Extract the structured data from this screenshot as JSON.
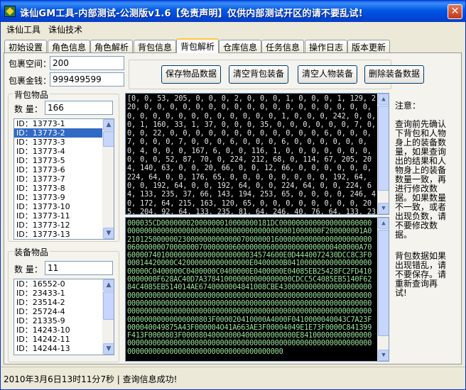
{
  "window": {
    "title": "诛仙GM工具-内部测试-公测版v1.6【免责声明】仅供内部测试开区的请不要乱试!",
    "close_icon": "close-icon"
  },
  "menu": [
    "诛仙工具",
    "诛仙技术"
  ],
  "tabs": [
    "初始设置",
    "角色信息",
    "角色解析",
    "背包信息",
    "背包解析",
    "仓库信息",
    "任务信息",
    "操作日志",
    "版本更新"
  ],
  "active_tab": "背包解析",
  "fields": {
    "space_label": "包裹空间：",
    "space_value": "200",
    "money_label": "包裹金钱：",
    "money_value": "999499599"
  },
  "bag_group": {
    "title": "背包物品",
    "count_label": "数 量：",
    "count_value": "166",
    "items": [
      "ID：13773-1",
      "ID：13773-2",
      "ID：13773-3",
      "ID：13773-4",
      "ID：13773-5",
      "ID：13773-6",
      "ID：13773-7",
      "ID：13773-8",
      "ID：13773-9",
      "ID：13773-10",
      "ID：13773-11",
      "ID：13773-12",
      "ID：13773-13"
    ],
    "selected": "ID：13773-2"
  },
  "equip_group": {
    "title": "装备物品",
    "count_label": "数 量：",
    "count_value": "11",
    "items": [
      "ID：16552-0",
      "ID：23433-1",
      "ID：23514-2",
      "ID：25724-4",
      "ID：21335-9",
      "ID：14243-10",
      "ID：14242-11",
      "ID：14244-13"
    ]
  },
  "buttons": {
    "save": "保存物品数据",
    "clear_bag": "清空背包装备",
    "clear_char": "清空人物装备",
    "delete_equip": "删除装备数据"
  },
  "dump_decimal": "[0, 0, 53, 205, 0, 0, 0, 2, 0, 0, 0, 1, 0, 0, 0, 1, 129, 220, 0, 0, 0, 0, 0, 0, 0, 0, 0, 0, 0, 0, 0, 0, 0, 0, 0, 0, 0, 0, 0, 0, 0, 0, 0, 0, 0, 0, 0, 0, 1, 0, 0, 0, 242, 0, 0, 0, 1, 160, 33, 1, 37, 0, 0, 0, 35, 0, 0, 0, 0, 0, 0, 7, 0, 0, 0, 22, 0, 0, 0, 0, 0, 0, 0, 0, 0, 0, 0, 0, 6, 0, 0, 0, 7, 0, 0, 0, 7, 0, 0, 0, 6, 0, 0, 0, 6, 0, 0, 0, 0, 0, 0, 0, 4, 0, 0, 0, 167, 6, 0, 0, 116, 1, 0, 0, 0, 0, 0, 0, 0, 0, 0, 0, 52, 87, 70, 0, 224, 212, 68, 0, 114, 67, 205, 204, 140, 63, 0, 0, 20, 66, 0, 0, 12, 66, 0, 0, 0, 0, 0, 0, 224, 64, 0, 0, 176, 65, 0, 0, 0, 0, 0, 0, 0, 0, 192, 64, 0, 0, 192, 64, 0, 0, 192, 64, 0, 0, 224, 64, 0, 0, 224, 64, 133, 235, 37, 66, 143, 194, 253, 65, 0, 0, 0, 0, 246, 40, 172, 64, 215, 163, 120, 65, 0, 0, 0, 0, 0, 0, 0, 0, 205, 204, 92, 64, 133, 235, 81, 64, 246, 40, 76, 64, 133, 235, 81, 64, 20, 174, 103, 64, 0, 0, 0, 0, 168, 65, 0, 128, 190, 67, 0, 0, 0, 0, 0, 0, 0, 0, 0, 0, 0, 0, 0, 0, 0, 0, 0, 0, 0, 0, 0, 0, 0, 0, 0, 0, 0, 0, 0, 0, 0, 0, 0, 0, 0, 0, 0, 0, 0, 0, 0, 0, 0, 0, 0, 0, 0, 0, 0, 0, 0, 0, 0, 0, 0, 0, 0, 128, 83, 0, 0, 32, 65, 0, 0, 1",
  "dump_hex": "000035CD00000002000000010000000181DC00000000000000000000000000000000000000000000000000000000000001000000F200000001A021012500000023000000000000070000001600000000000000000000000600000007000000070000000600000006000000000000000400000A706000074010000000000000000000034574600E0D4440072430DCC8C3F000014420000C42000000000000000E0400000B0410000000000000000000000C0400000C0400000C0400000E0400000E04085EB25428FC2FD4100000000F628AC40D7A378410000000000000000CDCC5C4085EB5140F6284C4085EB514014AE6740000004841008CBE430000000000000000000000000000000000000000000000000000000000000000000000000000000000000000000000000000000000000000000000000000000000000000000000000000000000000000000000000000000000000000000000000000000000000000000803F000020410000A4000F0410000040043C7A23F000040049875A43F000004O41A663AE3F00004049E1E73F0000C841399F413F0000803F000080400000004000000000000E8410000000000000000000000000000000000000000000000000000000000000000000000000000000000000000000000000000000000000",
  "note_top": "注意：\n\n查询前先确认\n下背包和人物\n身上的装备数\n量，如果查询\n出的结果和人\n物身上的装备\n数量一致，再\n进行修改数\n据。如果数量\n不一致，或者\n出现负数，请\n不要修改数\n据。",
  "note_bottom": "背包数据如果\n出现错乱，请\n不要保存。请\n重新查询再\n试!",
  "status": "2010年3月6日13时11分7秒  |  查询信息成功!"
}
